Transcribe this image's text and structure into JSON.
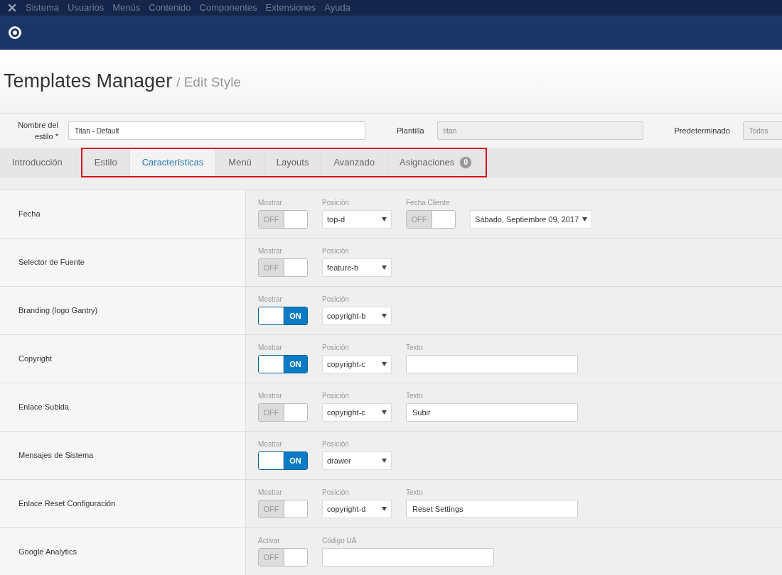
{
  "menu_bar": {
    "items": [
      "Sistema",
      "Usuarios",
      "Menús",
      "Contenido",
      "Componentes",
      "Extensiones",
      "Ayuda"
    ]
  },
  "page_title": {
    "title": "Templates Manager",
    "subtitle": "/ Edit Style"
  },
  "style_form": {
    "fields": [
      {
        "label": "Nombre del estilo *",
        "value": "Titan - Default",
        "readonly": false
      },
      {
        "label": "Plantilla",
        "value": "titan",
        "readonly": true
      },
      {
        "label": "Predeterminado",
        "value": "Todos",
        "readonly": true
      }
    ]
  },
  "tabs": [
    {
      "label": "Introducción",
      "selected": false,
      "highlighted": false
    },
    {
      "label": "Estilo",
      "selected": false,
      "highlighted": true
    },
    {
      "label": "Características",
      "selected": true,
      "highlighted": true
    },
    {
      "label": "Menú",
      "selected": false,
      "highlighted": true
    },
    {
      "label": "Layouts",
      "selected": false,
      "highlighted": true
    },
    {
      "label": "Avanzado",
      "selected": false,
      "highlighted": true
    },
    {
      "label": "Asignaciones",
      "selected": false,
      "highlighted": true,
      "badge": "0"
    }
  ],
  "features": [
    {
      "name": "Fecha",
      "controls": [
        {
          "kind": "toggle",
          "label": "Mostrar",
          "on": false,
          "text": "OFF"
        },
        {
          "kind": "select",
          "label": "Posición",
          "value": "top-d"
        },
        {
          "kind": "toggle",
          "label": "Fecha Cliente",
          "on": false,
          "text": "OFF"
        },
        {
          "kind": "wide_select",
          "value": "Sábado, Septiembre 09, 2017"
        }
      ]
    },
    {
      "name": "Selector de Fuente",
      "controls": [
        {
          "kind": "toggle",
          "label": "Mostrar",
          "on": false,
          "text": "OFF"
        },
        {
          "kind": "select",
          "label": "Posición",
          "value": "feature-b"
        }
      ]
    },
    {
      "name": "Branding (logo Gantry)",
      "controls": [
        {
          "kind": "toggle",
          "label": "Mostrar",
          "on": true,
          "text": "ON"
        },
        {
          "kind": "select",
          "label": "Posición",
          "value": "copyright-b"
        }
      ]
    },
    {
      "name": "Copyright",
      "controls": [
        {
          "kind": "toggle",
          "label": "Mostrar",
          "on": true,
          "text": "ON"
        },
        {
          "kind": "select",
          "label": "Posición",
          "value": "copyright-c"
        },
        {
          "kind": "text",
          "label": "Texto"
        }
      ]
    },
    {
      "name": "Enlace Subida",
      "controls": [
        {
          "kind": "toggle",
          "label": "Mostrar",
          "on": false,
          "text": "OFF"
        },
        {
          "kind": "select",
          "label": "Posición",
          "value": "copyright-c"
        },
        {
          "kind": "text",
          "label": "Texto",
          "value": "Subir"
        }
      ]
    },
    {
      "name": "Mensajes de Sistema",
      "controls": [
        {
          "kind": "toggle",
          "label": "Mostrar",
          "on": true,
          "text": "ON"
        },
        {
          "kind": "select",
          "label": "Posición",
          "value": "drawer"
        }
      ]
    },
    {
      "name": "Enlace Reset Configuración",
      "controls": [
        {
          "kind": "toggle",
          "label": "Mostrar",
          "on": false,
          "text": "OFF"
        },
        {
          "kind": "select",
          "label": "Posición",
          "value": "copyright-d"
        },
        {
          "kind": "text",
          "label": "Texto",
          "value": "Reset Settings"
        }
      ]
    },
    {
      "name": "Google Analytics",
      "controls": [
        {
          "kind": "toggle",
          "label": "Activar",
          "on": false,
          "text": "OFF"
        },
        {
          "kind": "text",
          "label": "Código UA"
        }
      ]
    }
  ]
}
